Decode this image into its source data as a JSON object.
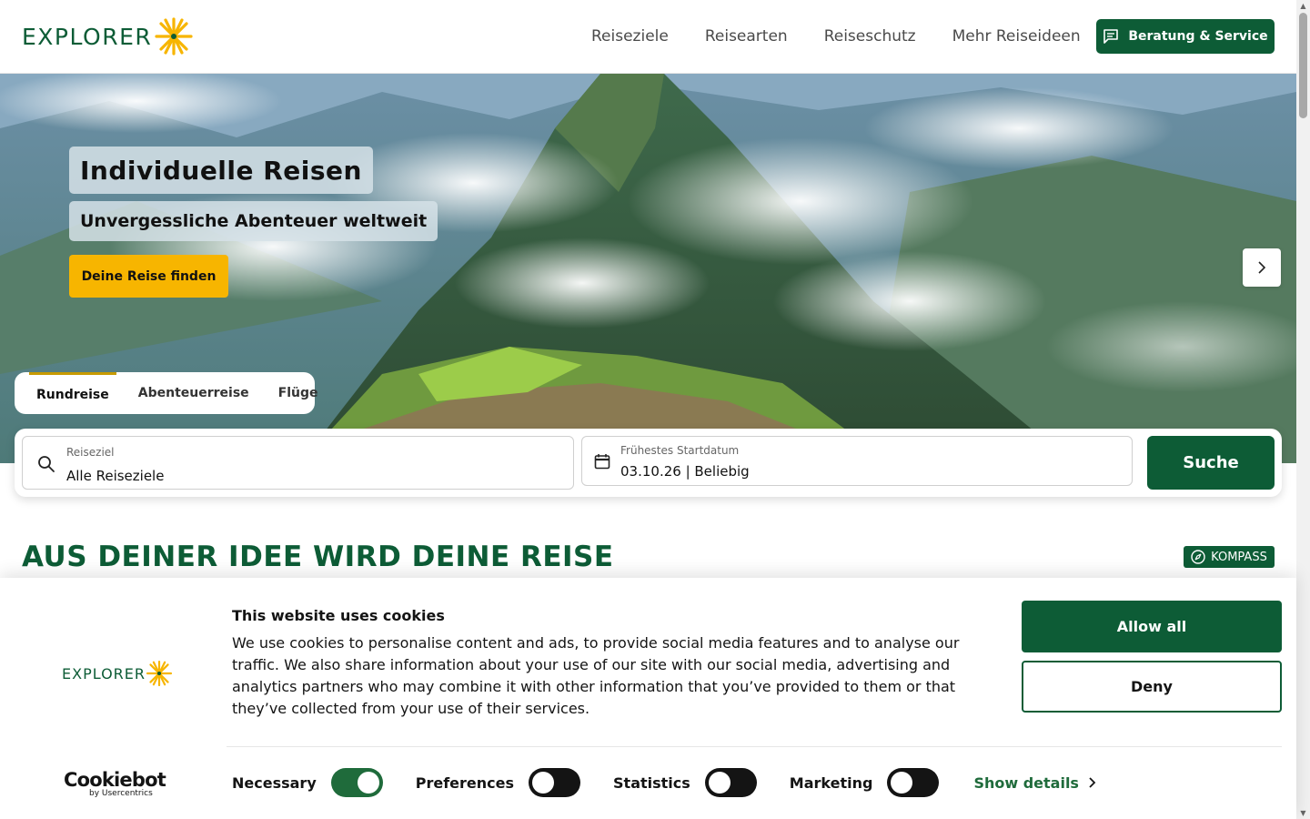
{
  "header": {
    "logo_text": "EXPLORER",
    "nav": [
      "Reiseziele",
      "Reisearten",
      "Reiseschutz",
      "Mehr Reiseideen"
    ],
    "service_button": "Beratung & Service"
  },
  "hero": {
    "title": "Individuelle Reisen",
    "subtitle": "Unvergessliche Abenteuer weltweit",
    "cta": "Deine Reise finden",
    "next_icon": "chevron-right-icon"
  },
  "search": {
    "tabs": [
      "Rundreise",
      "Abenteuerreise",
      "Flüge"
    ],
    "active_tab": "Rundreise",
    "destination_label": "Reiseziel",
    "destination_value": "Alle Reiseziele",
    "date_label": "Frühestes Startdatum",
    "date_value": "03.10.26 | Beliebig",
    "submit": "Suche"
  },
  "section": {
    "title": "AUS DEINER IDEE WIRD DEINE REISE",
    "badge": "KOMPASS"
  },
  "cookie": {
    "logo_text": "EXPLORER",
    "title": "This website uses cookies",
    "text": "We use cookies to personalise content and ads, to provide social media features and to analyse our traffic. We also share information about your use of our site with our social media, advertising and analytics partners who may combine it with other information that you’ve provided to them or that they’ve collected from your use of their services.",
    "allow": "Allow all",
    "deny": "Deny",
    "provider_name": "Cookiebot",
    "provider_sub": "by Usercentrics",
    "categories": [
      {
        "label": "Necessary",
        "checked": true
      },
      {
        "label": "Preferences",
        "checked": false
      },
      {
        "label": "Statistics",
        "checked": false
      },
      {
        "label": "Marketing",
        "checked": false
      }
    ],
    "show_details": "Show details"
  },
  "colors": {
    "brand_green": "#0d5c36",
    "accent_yellow": "#f7b500"
  }
}
